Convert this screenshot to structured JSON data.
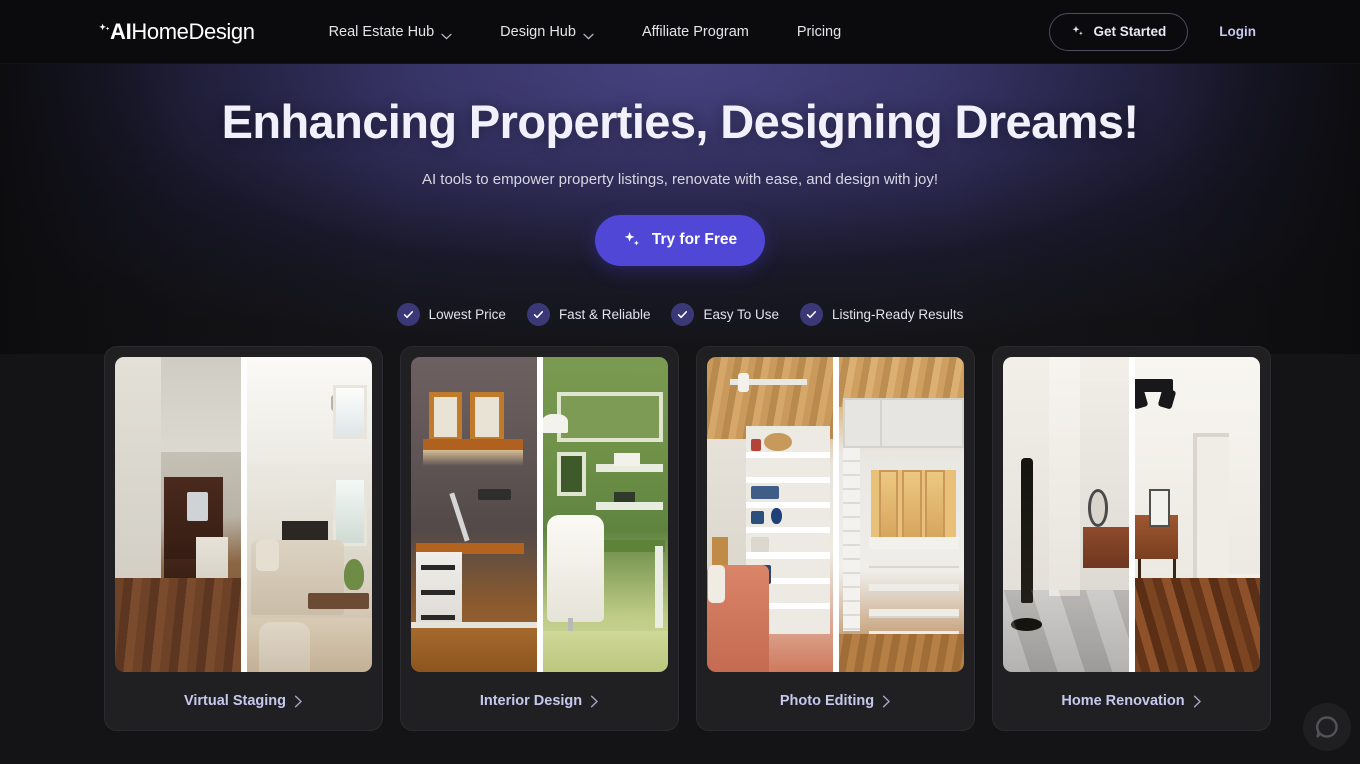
{
  "navbar": {
    "logo": {
      "icon": "sparkle-icon",
      "bold_part": "AI",
      "light_part": "HomeDesign"
    },
    "links": [
      {
        "label": "Real Estate Hub",
        "has_chevron": true,
        "icon": "chevron-down-icon"
      },
      {
        "label": "Design Hub",
        "has_chevron": true,
        "icon": "chevron-down-icon"
      },
      {
        "label": "Affiliate Program",
        "has_chevron": false
      },
      {
        "label": "Pricing",
        "has_chevron": false
      }
    ],
    "get_started_label": "Get Started",
    "get_started_icon": "sparkle-icon",
    "login_label": "Login"
  },
  "hero": {
    "title": "Enhancing Properties, Designing Dreams!",
    "subtitle": "AI tools to empower property listings, renovate with ease, and design with joy!",
    "cta_label": "Try for Free",
    "cta_icon": "sparkle-icon",
    "cta_color": "#5047d6"
  },
  "features": [
    {
      "label": "Lowest Price",
      "icon": "check-icon"
    },
    {
      "label": "Fast & Reliable",
      "icon": "check-icon"
    },
    {
      "label": "Easy To Use",
      "icon": "check-icon"
    },
    {
      "label": "Listing-Ready Results",
      "icon": "check-icon"
    }
  ],
  "cards": [
    {
      "label": "Virtual Staging",
      "arrow_icon": "chevron-right-icon"
    },
    {
      "label": "Interior Design",
      "arrow_icon": "chevron-right-icon"
    },
    {
      "label": "Photo Editing",
      "arrow_icon": "chevron-right-icon"
    },
    {
      "label": "Home Renovation",
      "arrow_icon": "chevron-right-icon"
    }
  ],
  "chat_widget": {
    "icon": "chat-bubble-icon"
  },
  "colors": {
    "accent": "#5047d6",
    "check_circle": "#3b3878",
    "card_label": "#c8c8ee",
    "page_background": "#141416",
    "navbar_background": "#0b0b0d"
  }
}
